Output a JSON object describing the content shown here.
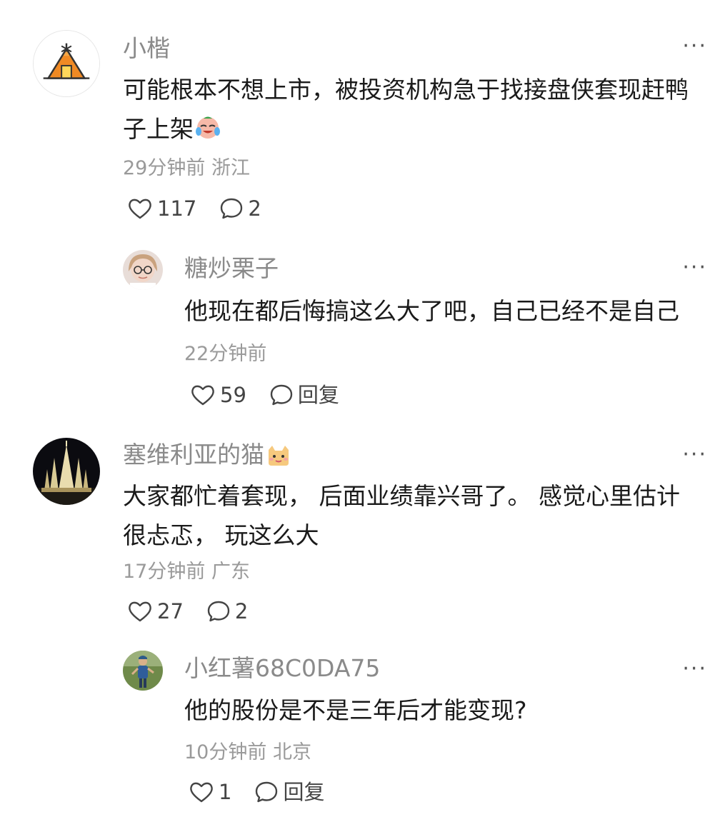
{
  "comments": [
    {
      "username": "小楷",
      "text": "可能根本不想上市，被投资机构急于找接盘侠套现赶鸭\n子上架",
      "text_emoji": "crying-laughing-emoji",
      "time": "29分钟前",
      "location": "浙江",
      "likes": "117",
      "replies": "2",
      "more": "···",
      "avatar_icon": "tent-icon"
    },
    {
      "username": "糖炒栗子",
      "text": "他现在都后悔搞这么大了吧，自己已经不是自己",
      "time": "22分钟前",
      "likes": "59",
      "reply_label": "回复",
      "more": "···"
    },
    {
      "username": "塞维利亚的猫",
      "username_emoji": "cat-emoji",
      "text": "大家都忙着套现， 后面业绩靠兴哥了。 感觉心里估计\n很忐忑， 玩这么大",
      "time": "17分钟前",
      "location": "广东",
      "likes": "27",
      "replies": "2",
      "more": "···"
    },
    {
      "username": "小红薯68C0DA75",
      "text": "他的股份是不是三年后才能变现?",
      "time": "10分钟前",
      "location": "北京",
      "likes": "1",
      "reply_label": "回复",
      "more": "···"
    }
  ],
  "colors": {
    "username": "#8a8a8a",
    "text": "#1a1a1a",
    "meta": "#9a9a9a",
    "tent_orange": "#f08a24"
  }
}
